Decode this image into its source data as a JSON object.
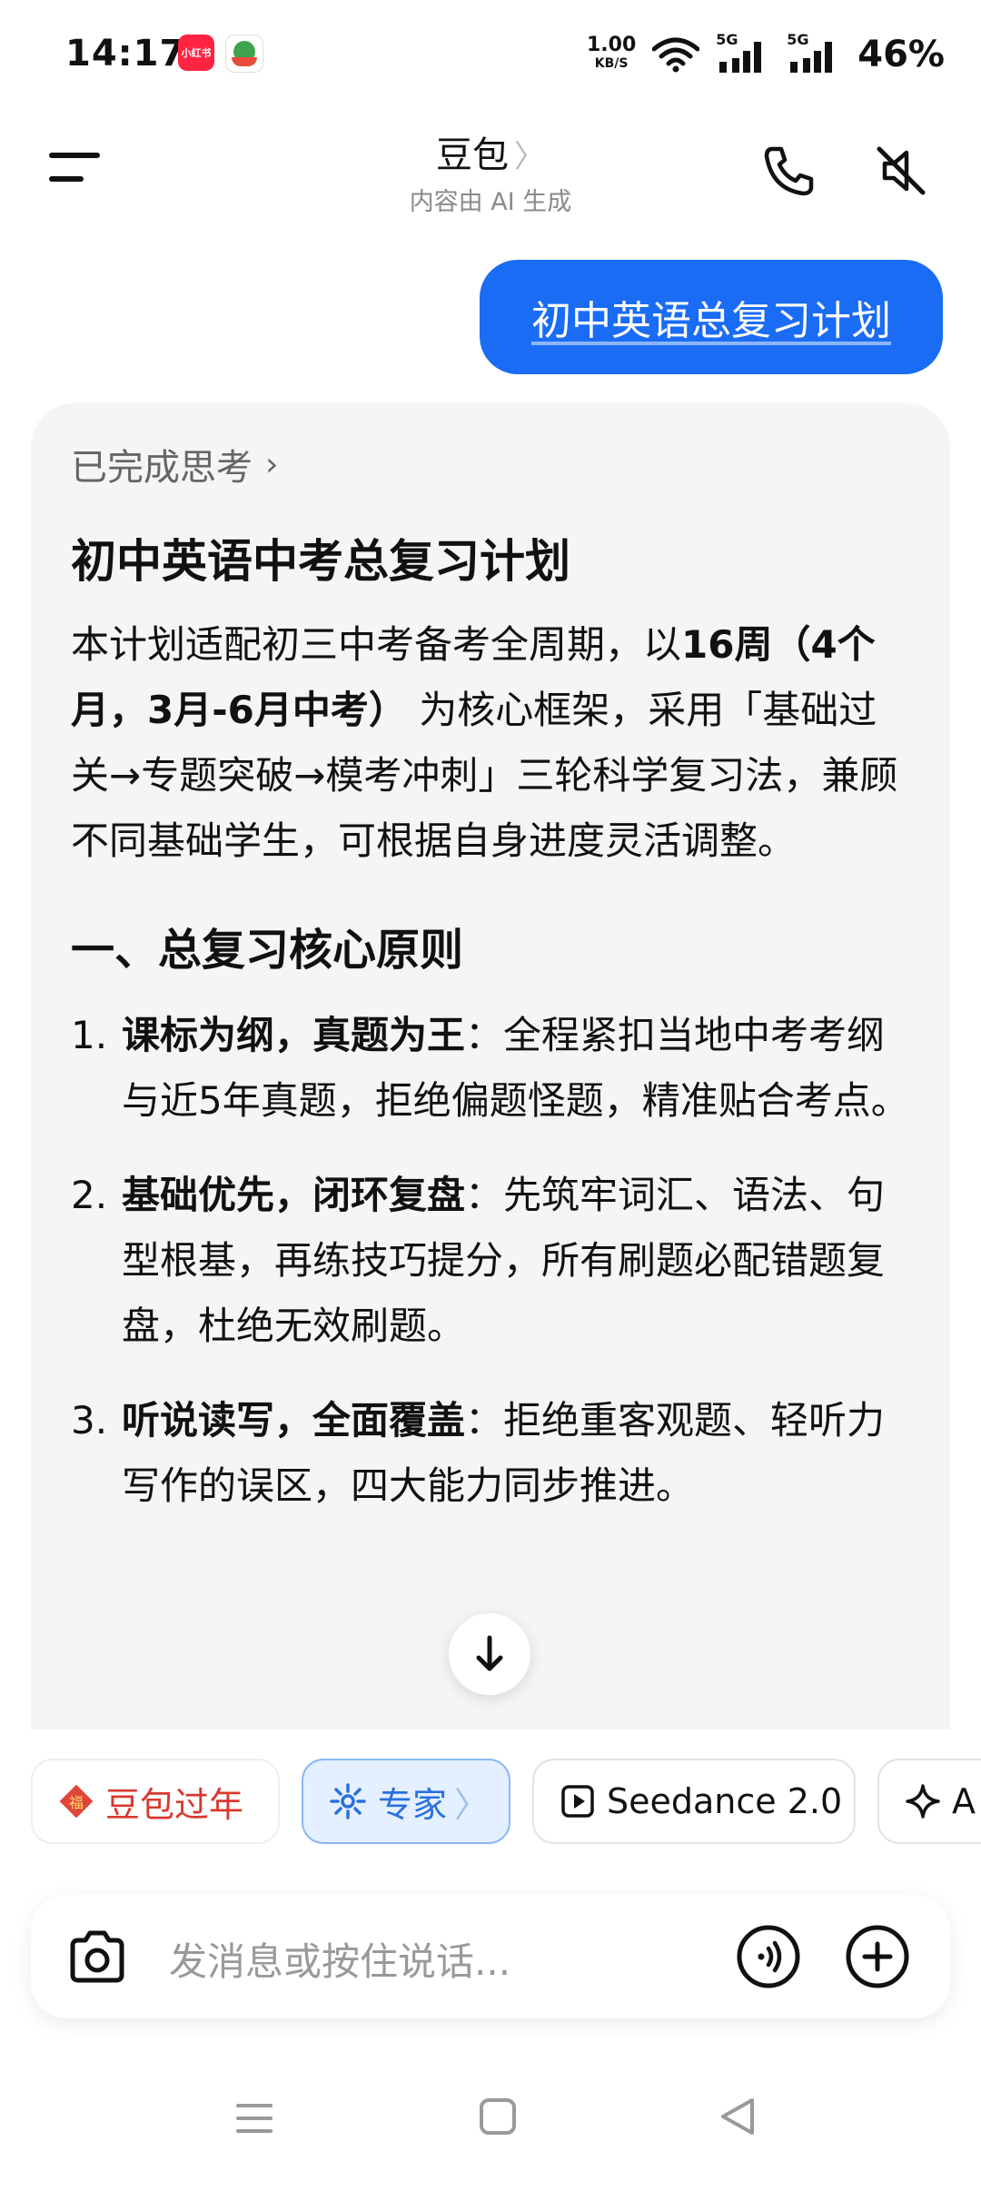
{
  "status_bar": {
    "time": "14:17",
    "xhs_label": "小红书",
    "net_speed_value": "1.00",
    "net_speed_unit": "KB/S",
    "signal_1": "5G",
    "signal_2": "5G",
    "battery": "46%"
  },
  "header": {
    "title": "豆包",
    "title_chevron": "〉",
    "subtitle": "内容由 AI 生成",
    "icons": [
      "menu-icon",
      "phone-icon",
      "mute-icon"
    ]
  },
  "user_message": "初中英语总复习计划",
  "answer": {
    "thinking_label": "已完成思考",
    "thinking_chevron": "›",
    "title": "初中英语中考总复习计划",
    "intro": {
      "p1": "本计划适配初三中考备考全周期，以",
      "b1": "16周（4个月，3月-6月中考）",
      "p2": " 为核心框架，采用「基础过关→专题突破→模考冲刺」三轮科学复习法，兼顾不同基础学生，可根据自身进度灵活调整。"
    },
    "section_title": "一、总复习核心原则",
    "principles": [
      {
        "num": "1.",
        "bold": "课标为纲，真题为王",
        "text": "：全程紧扣当地中考考纲与近5年真题，拒绝偏题怪题，精准贴合考点。"
      },
      {
        "num": "2.",
        "bold": "基础优先，闭环复盘",
        "text": "：先筑牢词汇、语法、句型根基，再练技巧提分，所有刷题必配错题复盘，杜绝无效刷题。"
      },
      {
        "num": "3.",
        "bold": "听说读写，全面覆盖",
        "text": "：拒绝重客观题、轻听力写作的误区，四大能力同步推进。"
      }
    ]
  },
  "chips": [
    {
      "label": "豆包过年",
      "icon": "fu-icon"
    },
    {
      "label": "专家",
      "chevron": "〉",
      "icon": "expert-icon"
    },
    {
      "label": "Seedance 2.0",
      "icon": "play-icon"
    },
    {
      "label": "A",
      "icon": "sparkle-icon"
    }
  ],
  "input": {
    "placeholder": "发消息或按住说话..."
  },
  "colors": {
    "accent_blue": "#1a6cf4",
    "chip_red": "#d8392f",
    "expert_blue": "#2b6fe0"
  }
}
